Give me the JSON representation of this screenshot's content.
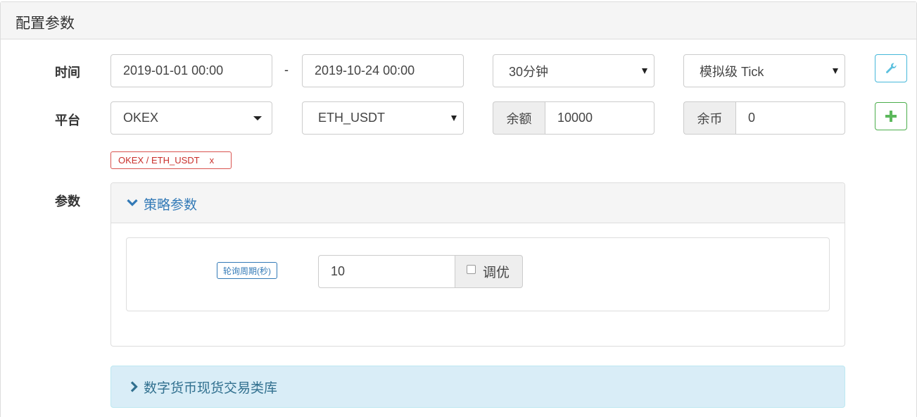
{
  "panel": {
    "title": "配置参数"
  },
  "labels": {
    "time": "时间",
    "platform": "平台",
    "params": "参数"
  },
  "time": {
    "start": "2019-01-01 00:00",
    "separator": "-",
    "end": "2019-10-24 00:00",
    "period": "30分钟",
    "mode": "模拟级 Tick"
  },
  "platform": {
    "exchange": "OKEX",
    "pair": "ETH_USDT",
    "balance_label": "余额",
    "balance": "10000",
    "coin_label": "余币",
    "coin": "0"
  },
  "selected_tag": {
    "label": "OKEX / ETH_USDT",
    "remove": "x"
  },
  "strategy": {
    "title": "策略参数",
    "params": [
      {
        "label": "轮询周期(秒)",
        "value": "10",
        "tune_label": "调优",
        "tune_checked": false
      }
    ]
  },
  "library": {
    "title": "数字货币现货交易类库"
  },
  "icons": {
    "settings": "wrench-icon",
    "add": "plus-icon",
    "expand": "chevron-down-icon",
    "collapsed": "chevron-right-icon"
  },
  "colors": {
    "primary": "#337ab7",
    "info_border": "#46b8da",
    "success": "#5cb85c",
    "danger": "#d9534f",
    "info_bg": "#d9edf7"
  }
}
